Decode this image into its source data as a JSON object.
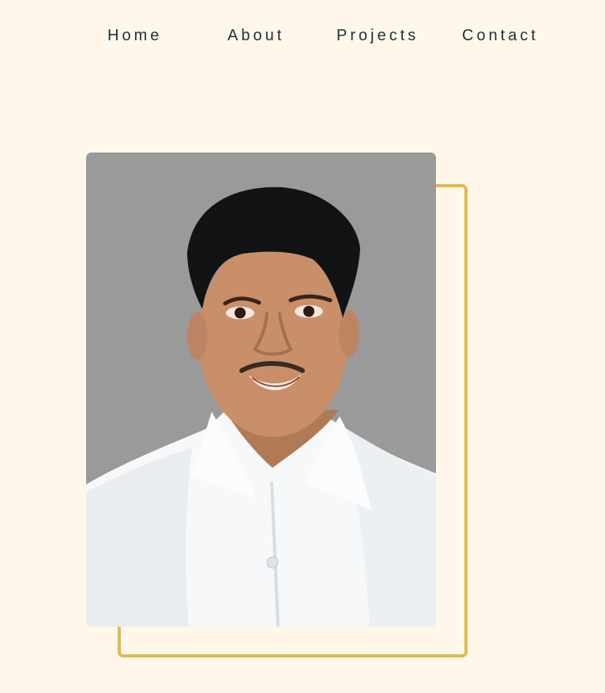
{
  "nav": {
    "home_label": "Home",
    "about_label": "About",
    "projects_label": "Projects",
    "contact_label": "Contact"
  },
  "colors": {
    "background": "#fff8ea",
    "text": "#1f2f3d",
    "accent": "#e2b94c",
    "photo_background": "#9a9a9a"
  },
  "hero": {
    "image_alt": "Profile portrait"
  }
}
